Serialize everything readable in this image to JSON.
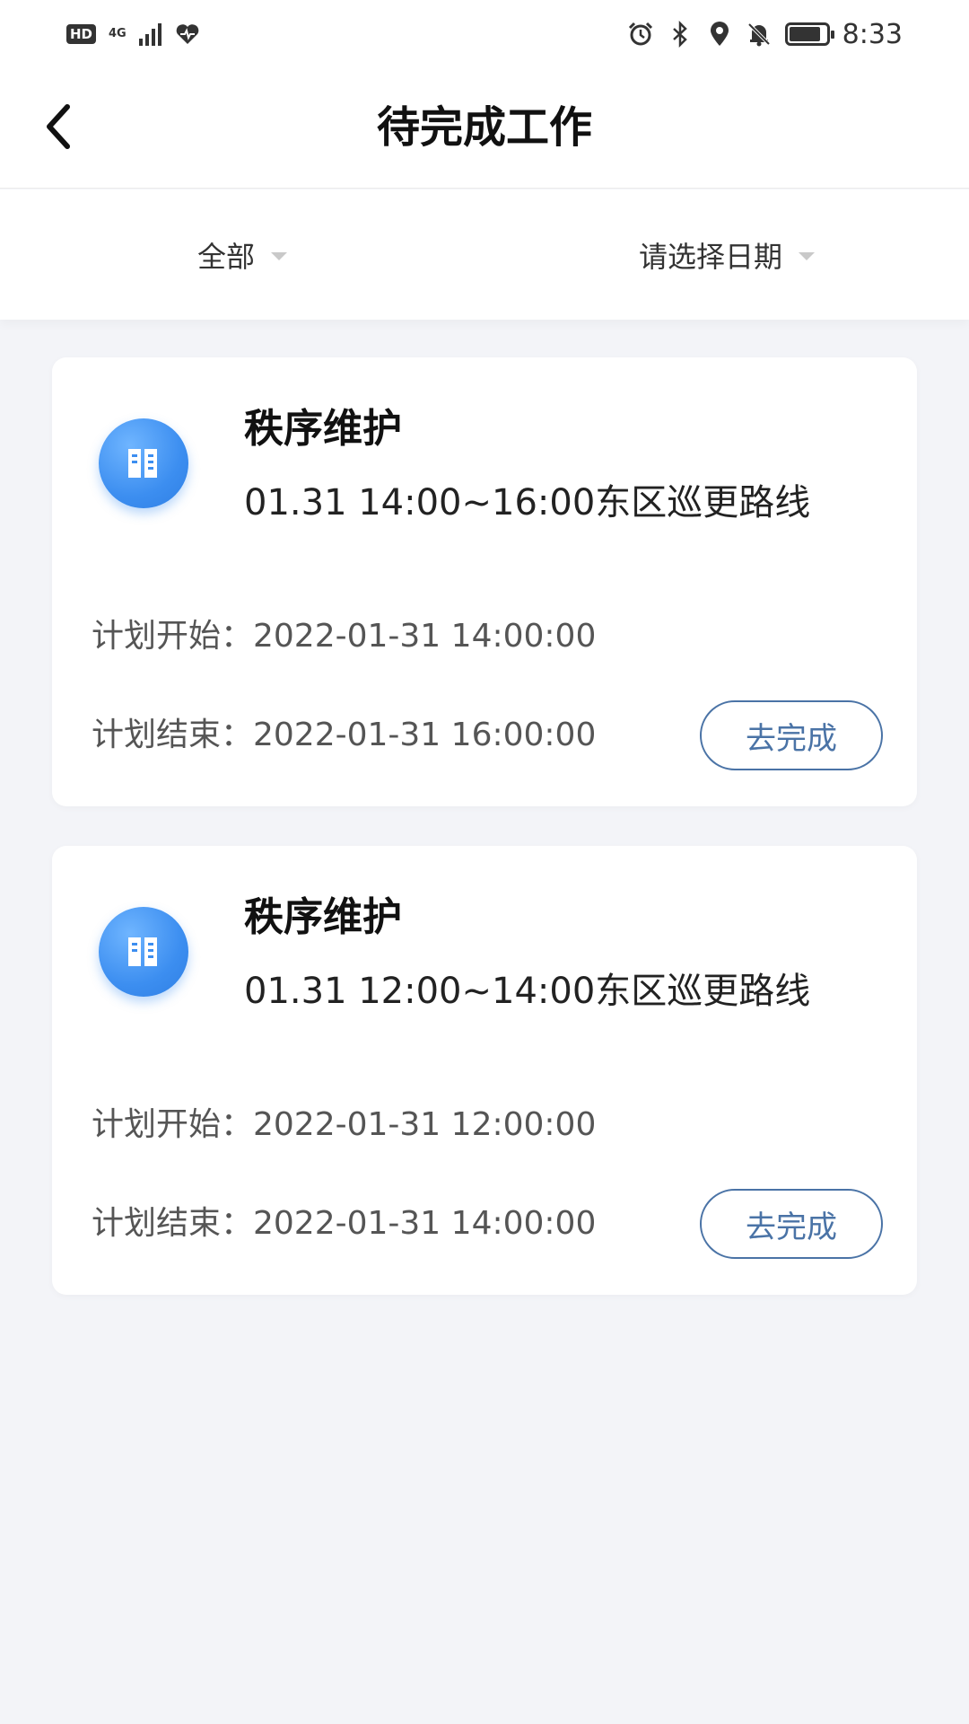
{
  "status_bar": {
    "hd": "HD",
    "network": "4G",
    "time": "8:33",
    "icons": [
      "alarm-icon",
      "bluetooth-icon",
      "location-icon",
      "mute-bell-icon"
    ],
    "battery_level": 0.85
  },
  "nav": {
    "title": "待完成工作",
    "back_icon": "chevron-left-icon"
  },
  "filters": {
    "type": "全部",
    "date": "请选择日期"
  },
  "tasks": [
    {
      "title": "秩序维护",
      "subtitle": "01.31 14:00~16:00东区巡更路线",
      "start": "计划开始：2022-01-31 14:00:00",
      "end": "计划结束：2022-01-31 16:00:00",
      "action": "去完成",
      "icon": "building-icon"
    },
    {
      "title": "秩序维护",
      "subtitle": "01.31 12:00~14:00东区巡更路线",
      "start": "计划开始：2022-01-31 12:00:00",
      "end": "计划结束：2022-01-31 14:00:00",
      "action": "去完成",
      "icon": "building-icon"
    }
  ],
  "colors": {
    "accent": "#4a73a6",
    "icon_blue": "#3c8ef0",
    "background": "#f3f4f8"
  }
}
